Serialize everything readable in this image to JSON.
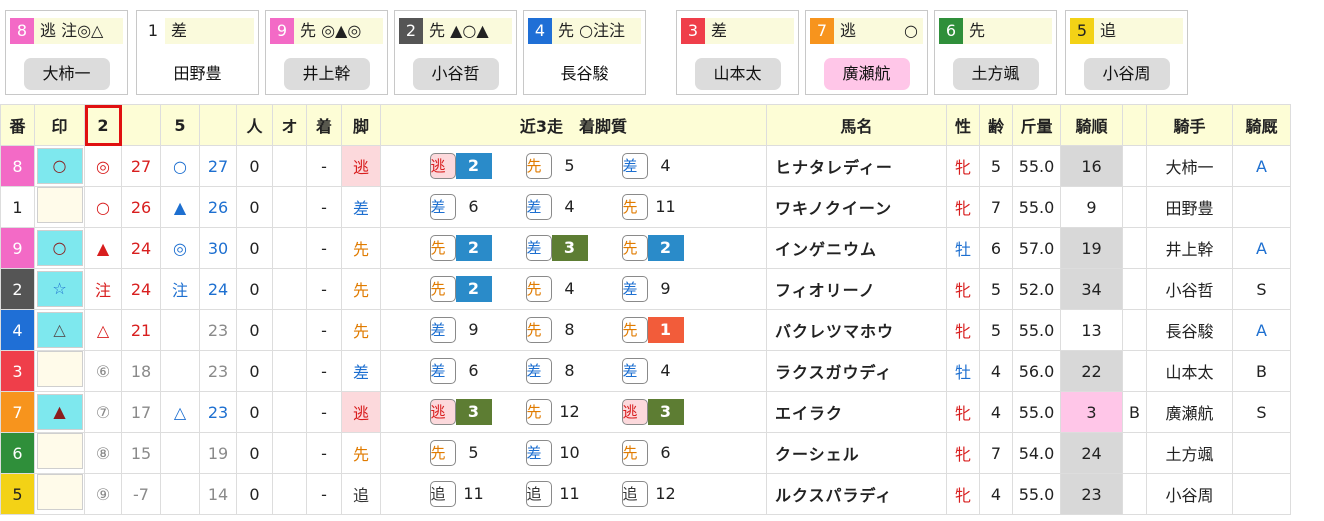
{
  "cards": [
    {
      "num": "8",
      "num_bg": "#f36ac6",
      "num_fg": "#ffffff",
      "mark": "逃 注◎△",
      "jockey": "大柿一",
      "jstyle": "gray"
    },
    {
      "num": "1",
      "num_bg": "#ffffff",
      "num_fg": "#222222",
      "mark": "差",
      "jockey": "田野豊",
      "jstyle": "plain"
    },
    {
      "num": "9",
      "num_bg": "#f36ac6",
      "num_fg": "#ffffff",
      "mark": "先 ◎▲◎",
      "jockey": "井上幹",
      "jstyle": "gray"
    },
    {
      "num": "2",
      "num_bg": "#555555",
      "num_fg": "#ffffff",
      "mark": "先 ▲○▲",
      "jockey": "小谷哲",
      "jstyle": "gray"
    },
    {
      "num": "4",
      "num_bg": "#1f6fd6",
      "num_fg": "#ffffff",
      "mark": "先 ○注注",
      "jockey": "長谷駿",
      "jstyle": "plain"
    },
    {
      "num": "3",
      "num_bg": "#ef3e4a",
      "num_fg": "#ffffff",
      "mark": "差",
      "jockey": "山本太",
      "jstyle": "gray"
    },
    {
      "num": "7",
      "num_bg": "#f7941d",
      "num_fg": "#ffffff",
      "mark": "逃　　　○",
      "jockey": "廣瀬航",
      "jstyle": "pink"
    },
    {
      "num": "6",
      "num_bg": "#2f8f3a",
      "num_fg": "#ffffff",
      "mark": "先",
      "jockey": "土方颯",
      "jstyle": "gray"
    },
    {
      "num": "5",
      "num_bg": "#f3d216",
      "num_fg": "#222222",
      "mark": "追",
      "jockey": "小谷周",
      "jstyle": "gray"
    }
  ],
  "headers": {
    "ban": "番",
    "shirushi": "印",
    "col2": "2",
    "col5": "5",
    "nin": "人",
    "o": "オ",
    "chaku": "着",
    "ashi": "脚",
    "recent": "近3走　着脚質",
    "name": "馬名",
    "sex": "性",
    "age": "齢",
    "weight": "斤量",
    "kijun": "騎順",
    "jockey": "騎手",
    "kyu": "騎厩"
  },
  "colors": {
    "style_bg": {
      "逃": "#fcd9dc",
      "先": "#ffffff",
      "差": "#ffffff",
      "追": "#ffffff"
    },
    "style_fg": {
      "逃": "#d81e1e",
      "先": "#e07b00",
      "差": "#1d6fd0",
      "追": "#333333"
    },
    "place_bg": {
      "1": "#f25c3a",
      "2": "#2a8bc9",
      "3": "#5d7d33"
    },
    "mark_bg": "#7ee8ee",
    "kijun_bg": "#d8d8d8",
    "kijun_pink": "#ffc6e8"
  },
  "rows": [
    {
      "ban": "8",
      "ban_bg": "#f36ac6",
      "ban_fg": "#ffffff",
      "mark": "○",
      "mark_color": "#8b1c1c",
      "mark_bg": true,
      "c2m": "◎",
      "c2m_c": "red",
      "c2v": "27",
      "c2v_c": "red",
      "c5m": "○",
      "c5m_c": "blue",
      "c5v": "27",
      "c5v_c": "blue",
      "nin": "0",
      "o": "",
      "chaku": "-",
      "ashi": "逃",
      "races": [
        {
          "s": "逃",
          "p": "2",
          "box": true
        },
        {
          "s": "先",
          "p": "5",
          "box": false
        },
        {
          "s": "差",
          "p": "4",
          "box": false
        }
      ],
      "name": "ヒナタレディー",
      "sex": "牝",
      "age": "5",
      "weight": "55.0",
      "kijun": "16",
      "kijun_bg": "gray",
      "extra": "",
      "jockey": "大柿一",
      "kyu": "A"
    },
    {
      "ban": "1",
      "ban_bg": "#ffffff",
      "ban_fg": "#222222",
      "mark": "",
      "mark_color": "#8b1c1c",
      "mark_bg": false,
      "c2m": "○",
      "c2m_c": "red",
      "c2v": "26",
      "c2v_c": "red",
      "c5m": "▲",
      "c5m_c": "blue",
      "c5v": "26",
      "c5v_c": "blue",
      "nin": "0",
      "o": "",
      "chaku": "-",
      "ashi": "差",
      "races": [
        {
          "s": "差",
          "p": "6",
          "box": false
        },
        {
          "s": "差",
          "p": "4",
          "box": false
        },
        {
          "s": "先",
          "p": "11",
          "box": false
        }
      ],
      "name": "ワキノクイーン",
      "sex": "牝",
      "age": "7",
      "weight": "55.0",
      "kijun": "9",
      "kijun_bg": "none",
      "extra": "",
      "jockey": "田野豊",
      "kyu": ""
    },
    {
      "ban": "9",
      "ban_bg": "#f36ac6",
      "ban_fg": "#ffffff",
      "mark": "○",
      "mark_color": "#8b1c1c",
      "mark_bg": true,
      "c2m": "▲",
      "c2m_c": "red",
      "c2v": "24",
      "c2v_c": "red",
      "c5m": "◎",
      "c5m_c": "blue",
      "c5v": "30",
      "c5v_c": "blue",
      "nin": "0",
      "o": "",
      "chaku": "-",
      "ashi": "先",
      "races": [
        {
          "s": "先",
          "p": "2",
          "box": true
        },
        {
          "s": "差",
          "p": "3",
          "box": true
        },
        {
          "s": "先",
          "p": "2",
          "box": true
        }
      ],
      "name": "インゲニウム",
      "sex": "牡",
      "age": "6",
      "weight": "57.0",
      "kijun": "19",
      "kijun_bg": "gray",
      "extra": "",
      "jockey": "井上幹",
      "kyu": "A"
    },
    {
      "ban": "2",
      "ban_bg": "#555555",
      "ban_fg": "#ffffff",
      "mark": "☆",
      "mark_color": "#1d6fd0",
      "mark_bg": true,
      "c2m": "注",
      "c2m_c": "red",
      "c2v": "24",
      "c2v_c": "red",
      "c5m": "注",
      "c5m_c": "blue",
      "c5v": "24",
      "c5v_c": "blue",
      "nin": "0",
      "o": "",
      "chaku": "-",
      "ashi": "先",
      "races": [
        {
          "s": "先",
          "p": "2",
          "box": true
        },
        {
          "s": "先",
          "p": "4",
          "box": false
        },
        {
          "s": "差",
          "p": "9",
          "box": false
        }
      ],
      "name": "フィオリーノ",
      "sex": "牝",
      "age": "5",
      "weight": "52.0",
      "kijun": "34",
      "kijun_bg": "gray",
      "extra": "",
      "jockey": "小谷哲",
      "kyu": "S"
    },
    {
      "ban": "4",
      "ban_bg": "#1f6fd6",
      "ban_fg": "#ffffff",
      "mark": "△",
      "mark_color": "#555555",
      "mark_bg": true,
      "c2m": "△",
      "c2m_c": "red",
      "c2v": "21",
      "c2v_c": "red",
      "c5m": "",
      "c5m_c": "blue",
      "c5v": "23",
      "c5v_c": "gray",
      "nin": "0",
      "o": "",
      "chaku": "-",
      "ashi": "先",
      "races": [
        {
          "s": "差",
          "p": "9",
          "box": false
        },
        {
          "s": "先",
          "p": "8",
          "box": false
        },
        {
          "s": "先",
          "p": "1",
          "box": true
        }
      ],
      "name": "バクレツマホウ",
      "sex": "牝",
      "age": "5",
      "weight": "55.0",
      "kijun": "13",
      "kijun_bg": "none",
      "extra": "",
      "jockey": "長谷駿",
      "kyu": "A"
    },
    {
      "ban": "3",
      "ban_bg": "#ef3e4a",
      "ban_fg": "#ffffff",
      "mark": "",
      "mark_color": "#8b1c1c",
      "mark_bg": false,
      "c2m": "⑥",
      "c2m_c": "gray",
      "c2v": "18",
      "c2v_c": "gray",
      "c5m": "",
      "c5m_c": "blue",
      "c5v": "23",
      "c5v_c": "gray",
      "nin": "0",
      "o": "",
      "chaku": "-",
      "ashi": "差",
      "races": [
        {
          "s": "差",
          "p": "6",
          "box": false
        },
        {
          "s": "差",
          "p": "8",
          "box": false
        },
        {
          "s": "差",
          "p": "4",
          "box": false
        }
      ],
      "name": "ラクスガウディ",
      "sex": "牡",
      "age": "4",
      "weight": "56.0",
      "kijun": "22",
      "kijun_bg": "gray",
      "extra": "",
      "jockey": "山本太",
      "kyu": "B"
    },
    {
      "ban": "7",
      "ban_bg": "#f7941d",
      "ban_fg": "#ffffff",
      "mark": "▲",
      "mark_color": "#8b1c1c",
      "mark_bg": true,
      "c2m": "⑦",
      "c2m_c": "gray",
      "c2v": "17",
      "c2v_c": "gray",
      "c5m": "△",
      "c5m_c": "blue",
      "c5v": "23",
      "c5v_c": "blue",
      "nin": "0",
      "o": "",
      "chaku": "-",
      "ashi": "逃",
      "races": [
        {
          "s": "逃",
          "p": "3",
          "box": true
        },
        {
          "s": "先",
          "p": "12",
          "box": false
        },
        {
          "s": "逃",
          "p": "3",
          "box": true
        }
      ],
      "name": "エイラク",
      "sex": "牝",
      "age": "4",
      "weight": "55.0",
      "kijun": "3",
      "kijun_bg": "pink",
      "extra": "B",
      "jockey": "廣瀬航",
      "kyu": "S"
    },
    {
      "ban": "6",
      "ban_bg": "#2f8f3a",
      "ban_fg": "#ffffff",
      "mark": "",
      "mark_color": "#8b1c1c",
      "mark_bg": false,
      "c2m": "⑧",
      "c2m_c": "gray",
      "c2v": "15",
      "c2v_c": "gray",
      "c5m": "",
      "c5m_c": "blue",
      "c5v": "19",
      "c5v_c": "gray",
      "nin": "0",
      "o": "",
      "chaku": "-",
      "ashi": "先",
      "races": [
        {
          "s": "先",
          "p": "5",
          "box": false
        },
        {
          "s": "差",
          "p": "10",
          "box": false
        },
        {
          "s": "先",
          "p": "6",
          "box": false
        }
      ],
      "name": "クーシェル",
      "sex": "牝",
      "age": "7",
      "weight": "54.0",
      "kijun": "24",
      "kijun_bg": "gray",
      "extra": "",
      "jockey": "土方颯",
      "kyu": ""
    },
    {
      "ban": "5",
      "ban_bg": "#f3d216",
      "ban_fg": "#222222",
      "mark": "",
      "mark_color": "#8b1c1c",
      "mark_bg": false,
      "c2m": "⑨",
      "c2m_c": "gray",
      "c2v": "-7",
      "c2v_c": "gray",
      "c5m": "",
      "c5m_c": "blue",
      "c5v": "14",
      "c5v_c": "gray",
      "nin": "0",
      "o": "",
      "chaku": "-",
      "ashi": "追",
      "races": [
        {
          "s": "追",
          "p": "11",
          "box": false
        },
        {
          "s": "追",
          "p": "11",
          "box": false
        },
        {
          "s": "追",
          "p": "12",
          "box": false
        }
      ],
      "name": "ルクスパラディ",
      "sex": "牝",
      "age": "4",
      "weight": "55.0",
      "kijun": "23",
      "kijun_bg": "gray",
      "extra": "",
      "jockey": "小谷周",
      "kyu": ""
    }
  ]
}
